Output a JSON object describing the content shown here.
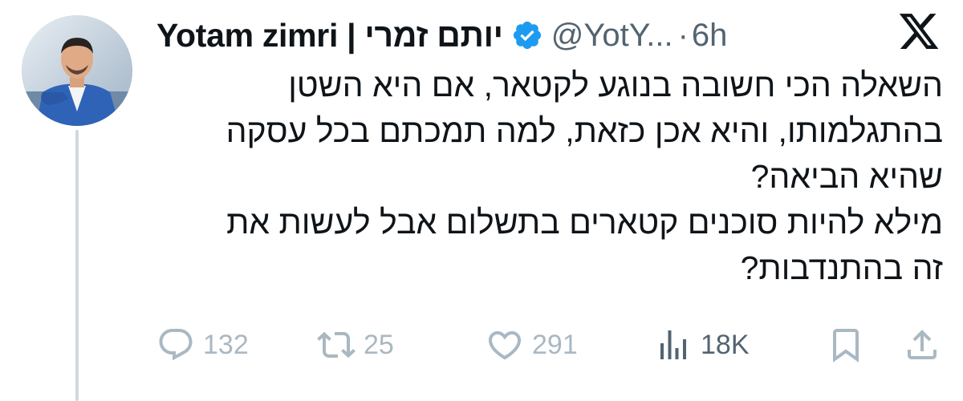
{
  "author": {
    "display_name": "Yotam zimri | יותם זמרי",
    "handle": "@YotY...",
    "separator": "·",
    "time": "6h",
    "verified": true,
    "avatar_icon": "profile-photo"
  },
  "tweet": {
    "lines": [
      "השאלה הכי חשובה בנוגע לקטאר, אם היא השטן",
      "בהתגלמותו, והיא אכן כזאת, למה תמכתם בכל עסקה",
      "שהיא הביאה?",
      "מילא להיות סוכנים קטארים בתשלום אבל לעשות את",
      "זה בהתנדבות?"
    ]
  },
  "actions": {
    "reply": {
      "icon": "reply-icon",
      "count": "132"
    },
    "retweet": {
      "icon": "retweet-icon",
      "count": "25"
    },
    "like": {
      "icon": "heart-icon",
      "count": "291"
    },
    "views": {
      "icon": "views-icon",
      "count": "18K"
    },
    "bookmark": {
      "icon": "bookmark-icon"
    },
    "share": {
      "icon": "share-icon"
    }
  },
  "colors": {
    "text": "#0f1419",
    "muted": "#536471",
    "faded_icon": "#aab8c2",
    "verified_blue": "#1d9bf0",
    "thread_line": "#cfd9de"
  }
}
